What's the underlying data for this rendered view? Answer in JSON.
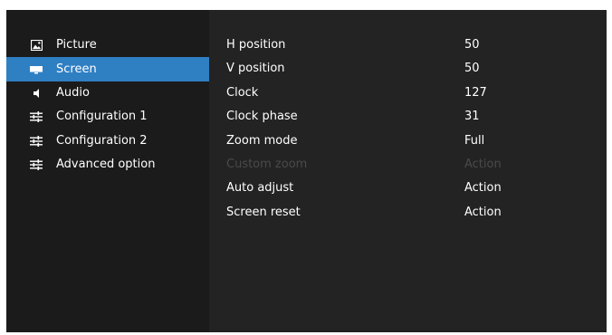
{
  "menu": {
    "items": [
      {
        "label": "Picture",
        "icon": "picture-icon"
      },
      {
        "label": "Screen",
        "icon": "screen-icon",
        "selected": true
      },
      {
        "label": "Audio",
        "icon": "speaker-icon"
      },
      {
        "label": "Configuration 1",
        "icon": "sliders-icon"
      },
      {
        "label": "Configuration 2",
        "icon": "sliders-icon"
      },
      {
        "label": "Advanced option",
        "icon": "sliders-icon"
      }
    ]
  },
  "screen_settings": {
    "rows": [
      {
        "name": "H position",
        "value": "50"
      },
      {
        "name": "V position",
        "value": "50"
      },
      {
        "name": "Clock",
        "value": "127"
      },
      {
        "name": "Clock phase",
        "value": "31"
      },
      {
        "name": "Zoom mode",
        "value": "Full"
      },
      {
        "name": "Custom zoom",
        "value": "Action",
        "disabled": true
      },
      {
        "name": "Auto adjust",
        "value": "Action"
      },
      {
        "name": "Screen reset",
        "value": "Action"
      }
    ]
  },
  "colors": {
    "selected": "#2f7fc3",
    "panel_left": "#1b1b1b",
    "panel_right": "#232323",
    "disabled_text": "#4a4a4a"
  }
}
